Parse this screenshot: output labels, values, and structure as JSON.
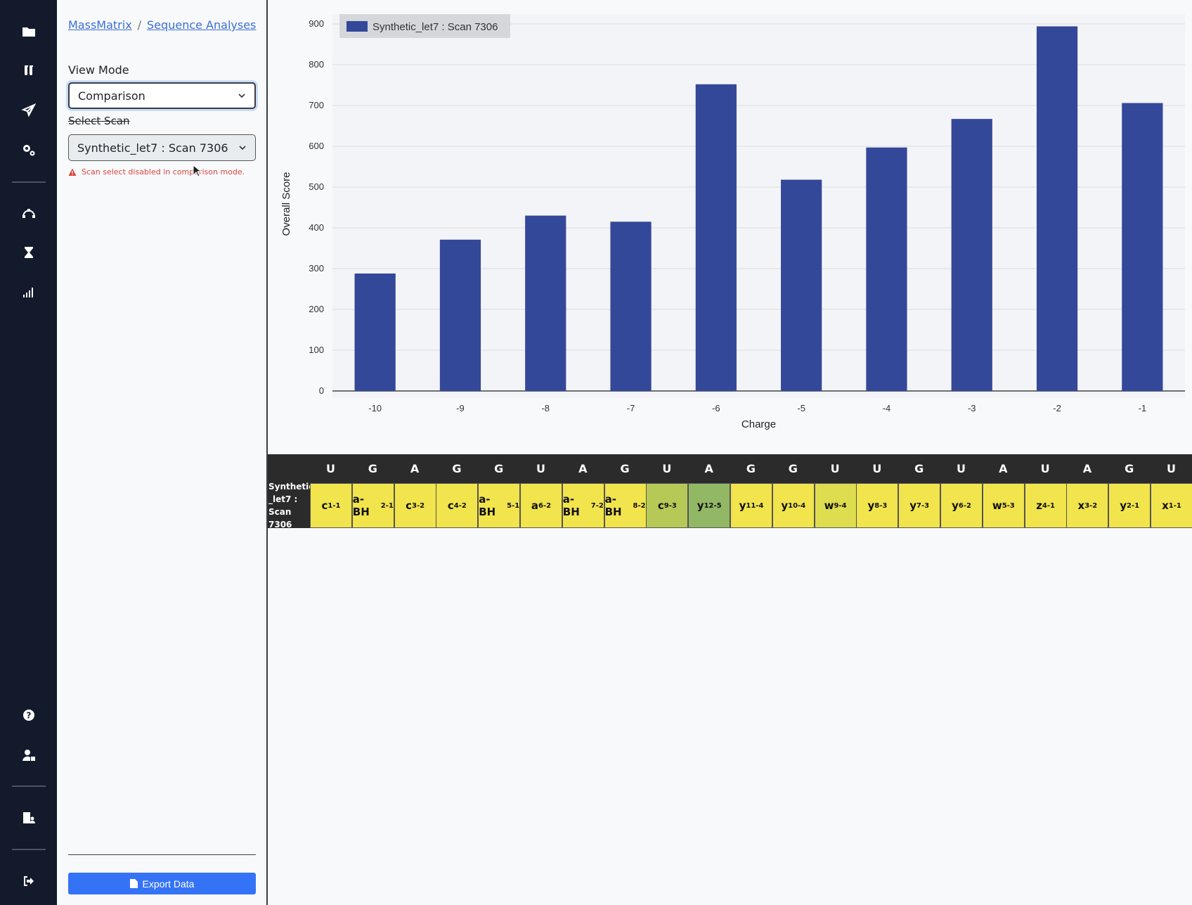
{
  "rail": {
    "top_icons": [
      "folder-icon",
      "test-tubes-icon",
      "send-icon",
      "gears-icon"
    ],
    "mid_icons": [
      "bezier-icon",
      "hourglass-icon",
      "signal-bars-icon"
    ],
    "bottom_icons": [
      "help-circle-icon",
      "user-lock-icon",
      "building-user-icon",
      "sign-out-icon"
    ]
  },
  "breadcrumb": {
    "root": "MassMatrix",
    "sep": "/",
    "current": "Sequence Analyses"
  },
  "view_mode": {
    "label": "View Mode",
    "value": "Comparison"
  },
  "select_scan": {
    "label": "Select Scan",
    "value": "Synthetic_let7 : Scan 7306"
  },
  "warning": "Scan select disabled in comparison mode.",
  "export_label": "Export Data",
  "colors": {
    "bar": "#34489a",
    "rail": "#121a2c",
    "accent": "#3573f6"
  },
  "chart_data": {
    "type": "bar",
    "categories": [
      "-10",
      "-9",
      "-8",
      "-7",
      "-6",
      "-5",
      "-4",
      "-3",
      "-2",
      "-1"
    ],
    "series": [
      {
        "name": "Synthetic_let7 : Scan 7306",
        "values": [
          288,
          371,
          430,
          415,
          752,
          518,
          597,
          667,
          894,
          706
        ]
      }
    ],
    "xlabel": "Charge",
    "ylabel": "Overall Score",
    "ylim": [
      0,
      900
    ],
    "yticks": [
      0,
      100,
      200,
      300,
      400,
      500,
      600,
      700,
      800,
      900
    ],
    "grid": true,
    "legend": "top-left"
  },
  "sequence": {
    "row_label_lines": [
      "Synthetic",
      "_let7 :",
      "Scan 7306"
    ],
    "nucleotides": [
      "U",
      "G",
      "A",
      "G",
      "G",
      "U",
      "A",
      "G",
      "U",
      "A",
      "G",
      "G",
      "U",
      "U",
      "G",
      "U",
      "A",
      "U",
      "A",
      "G",
      "U"
    ],
    "cells": [
      {
        "base": "c",
        "sub": "1",
        "sup": "-1",
        "color": "#f2e44c"
      },
      {
        "base": "a-BH",
        "sub": "2",
        "sup": "-1",
        "color": "#f2e44c"
      },
      {
        "base": "c",
        "sub": "3",
        "sup": "-2",
        "color": "#f2e44c"
      },
      {
        "base": "c",
        "sub": "4",
        "sup": "-2",
        "color": "#f2e44c"
      },
      {
        "base": "a-BH",
        "sub": "5",
        "sup": "-1",
        "color": "#f2e44c"
      },
      {
        "base": "a",
        "sub": "6",
        "sup": "-2",
        "color": "#f2e44c"
      },
      {
        "base": "a-BH",
        "sub": "7",
        "sup": "-2",
        "color": "#f2e44c"
      },
      {
        "base": "a-BH",
        "sub": "8",
        "sup": "-2",
        "color": "#f2e44c"
      },
      {
        "base": "c",
        "sub": "9",
        "sup": "-3",
        "color": "#b6c957"
      },
      {
        "base": "y",
        "sub": "12",
        "sup": "-5",
        "color": "#93b865"
      },
      {
        "base": "y",
        "sub": "11",
        "sup": "-4",
        "color": "#f2e44c"
      },
      {
        "base": "y",
        "sub": "10",
        "sup": "-4",
        "color": "#f2e44c"
      },
      {
        "base": "w",
        "sub": "9",
        "sup": "-4",
        "color": "#dedc4f"
      },
      {
        "base": "y",
        "sub": "8",
        "sup": "-3",
        "color": "#f2e44c"
      },
      {
        "base": "y",
        "sub": "7",
        "sup": "-3",
        "color": "#f2e44c"
      },
      {
        "base": "y",
        "sub": "6",
        "sup": "-2",
        "color": "#f2e44c"
      },
      {
        "base": "w",
        "sub": "5",
        "sup": "-3",
        "color": "#f2e44c"
      },
      {
        "base": "z",
        "sub": "4",
        "sup": "-1",
        "color": "#f2e44c"
      },
      {
        "base": "x",
        "sub": "3",
        "sup": "-2",
        "color": "#f2e44c"
      },
      {
        "base": "y",
        "sub": "2",
        "sup": "-1",
        "color": "#f2e44c"
      },
      {
        "base": "x",
        "sub": "1",
        "sup": "-1",
        "color": "#f2e44c"
      }
    ]
  }
}
